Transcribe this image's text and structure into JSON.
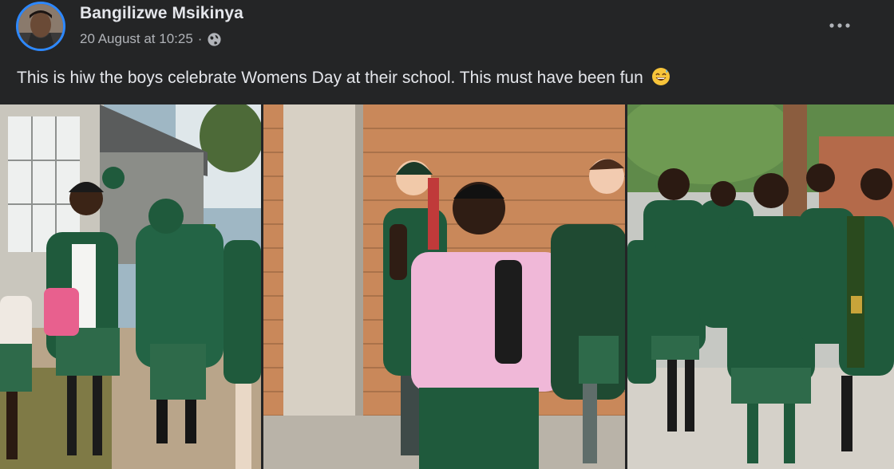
{
  "post": {
    "author": "Bangilizwe Msikinya",
    "timestamp": "20 August at 10:25",
    "separator": "·",
    "privacy_icon": "globe-icon",
    "more_icon": "more-options-icon",
    "caption": "This is hiw the boys celebrate Womens Day at their school. This must have been fun",
    "caption_emoji": "grinning-sweat-emoji"
  },
  "media": [
    {
      "name": "photo-1",
      "description_icon": "photo"
    },
    {
      "name": "photo-2",
      "description_icon": "photo"
    },
    {
      "name": "photo-3",
      "description_icon": "photo"
    }
  ],
  "colors": {
    "background": "#242526",
    "text_primary": "#e4e6eb",
    "text_secondary": "#b0b3b8",
    "avatar_ring": "#2d88ff",
    "blazer_green": "#1f5a3c",
    "pink_shirt": "#f0b8d8"
  }
}
